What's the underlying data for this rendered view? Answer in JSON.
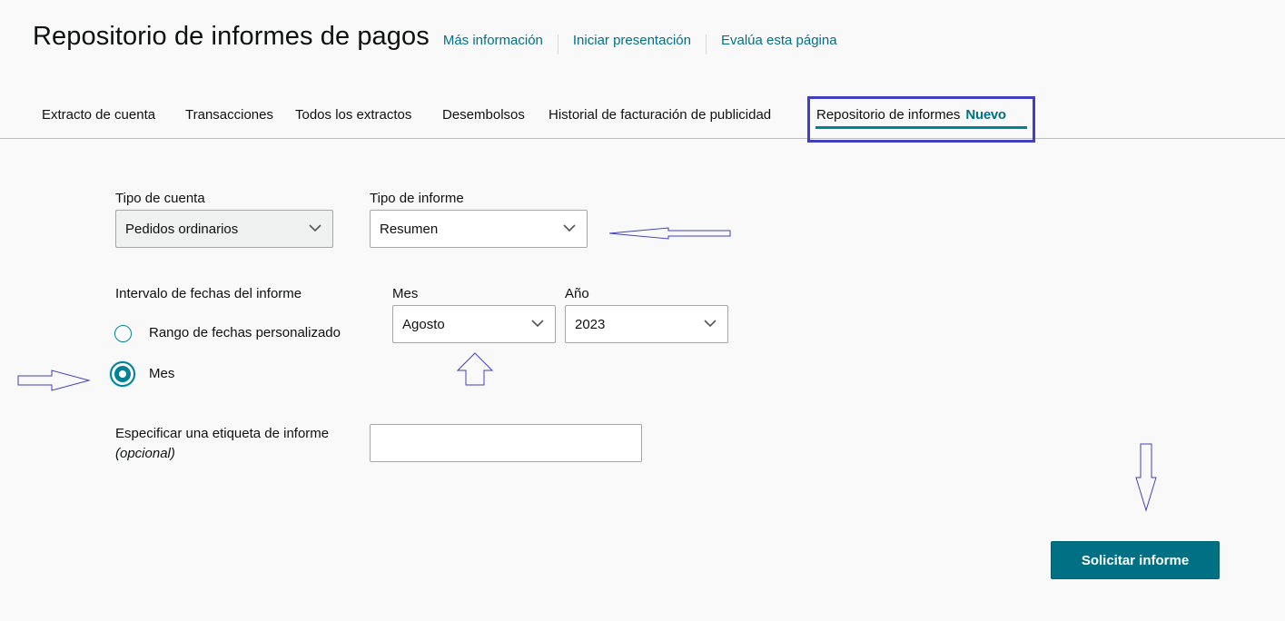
{
  "header": {
    "title": "Repositorio de informes de pagos",
    "links": [
      "Más información",
      "Iniciar presentación",
      "Evalúa esta página"
    ]
  },
  "tabs": [
    {
      "label": "Extracto de cuenta"
    },
    {
      "label": "Transacciones"
    },
    {
      "label": "Todos los extractos"
    },
    {
      "label": "Desembolsos"
    },
    {
      "label": "Historial de facturación de publicidad"
    },
    {
      "label": "Repositorio de informes",
      "badge": "Nuevo",
      "active": true
    }
  ],
  "form": {
    "account_type": {
      "label": "Tipo de cuenta",
      "value": "Pedidos ordinarios"
    },
    "report_type": {
      "label": "Tipo de informe",
      "value": "Resumen"
    },
    "date_range": {
      "label": "Intervalo de fechas del informe",
      "option_custom": "Rango de fechas personalizado",
      "option_month": "Mes",
      "selected": "Mes"
    },
    "month": {
      "label": "Mes",
      "value": "Agosto"
    },
    "year": {
      "label": "Año",
      "value": "2023"
    },
    "report_tag": {
      "label": "Especificar una etiqueta de informe",
      "optional": "(opcional)",
      "value": ""
    }
  },
  "actions": {
    "request_report": "Solicitar informe"
  },
  "colors": {
    "accent": "#007185",
    "annotation": "#4040c0"
  }
}
